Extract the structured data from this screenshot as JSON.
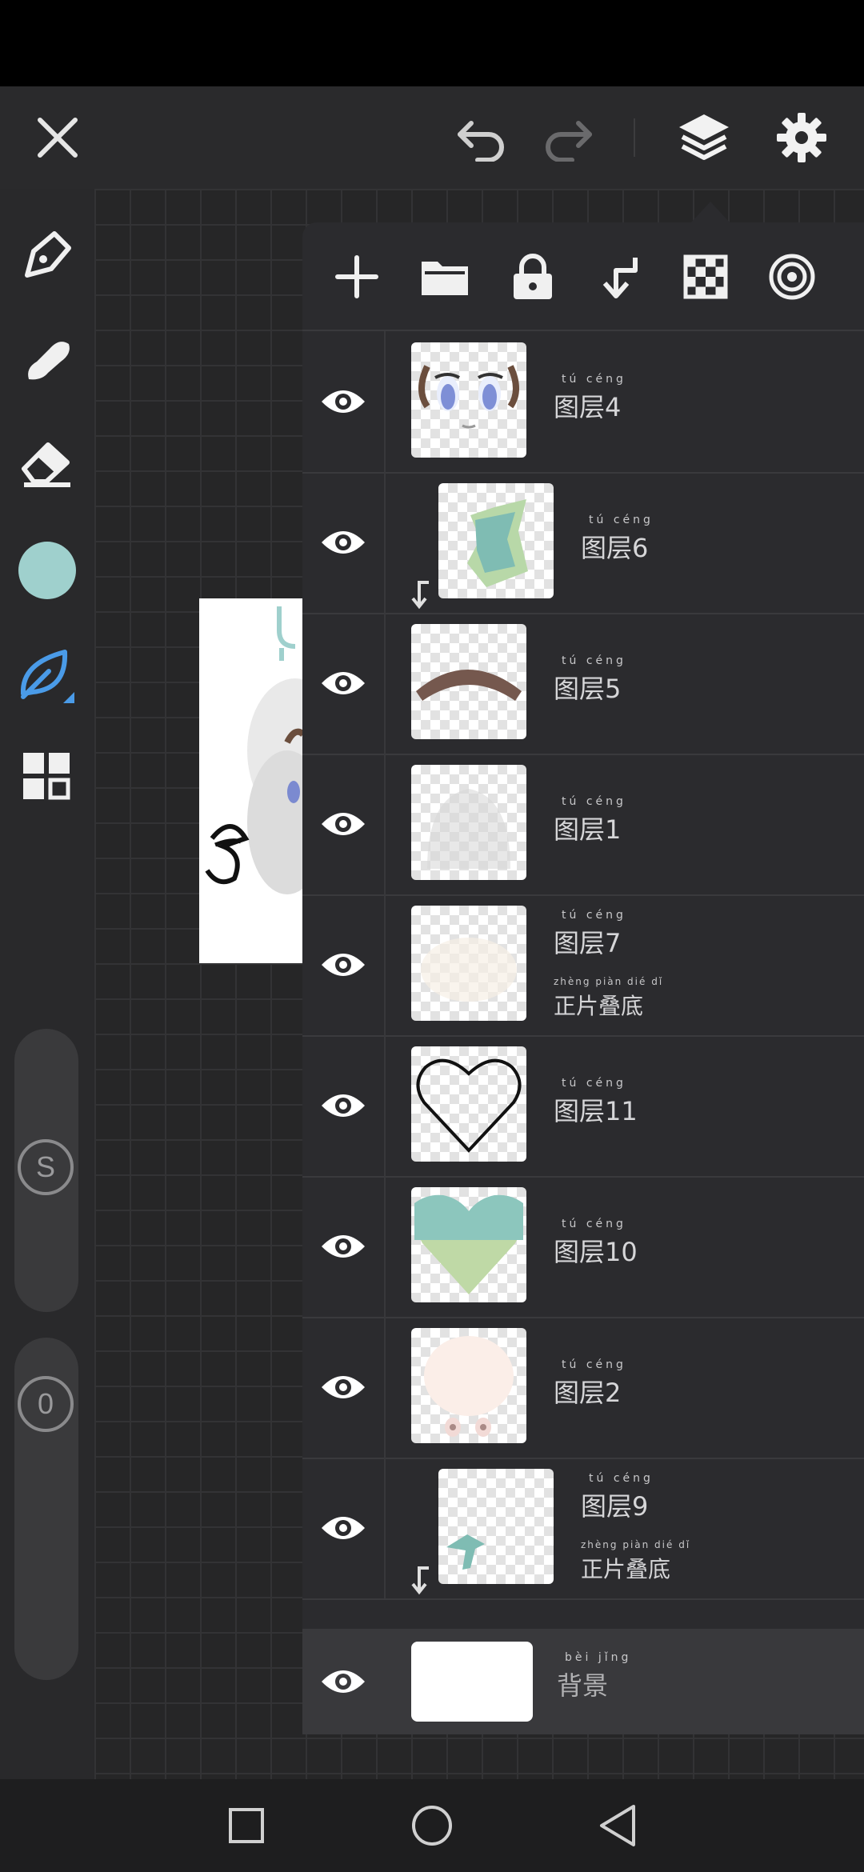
{
  "app": {
    "accent": "#4a9be8",
    "color_swatch": "#9fd0cd"
  },
  "topbar": {
    "close_icon": "close-icon",
    "undo_icon": "undo-icon",
    "redo_icon": "redo-icon",
    "layers_icon": "layers-icon",
    "settings_icon": "gear-icon"
  },
  "sidebar": {
    "tools": [
      "pen-icon",
      "smudge-icon",
      "eraser-icon",
      "color-swatch",
      "leaf-brush-icon",
      "grid-menu-icon"
    ],
    "size_label": "S",
    "opacity_label": "0"
  },
  "layer_panel": {
    "tools": [
      "add-layer-icon",
      "folder-icon",
      "lock-icon",
      "clip-mask-icon",
      "transparency-lock-icon",
      "target-icon"
    ],
    "layers": [
      {
        "pinyin": "tú céng",
        "name": "图层4",
        "blend_pinyin": "",
        "blend": "",
        "clipped": false
      },
      {
        "pinyin": "tú céng",
        "name": "图层6",
        "blend_pinyin": "",
        "blend": "",
        "clipped": true
      },
      {
        "pinyin": "tú céng",
        "name": "图层5",
        "blend_pinyin": "",
        "blend": "",
        "clipped": false
      },
      {
        "pinyin": "tú céng",
        "name": "图层1",
        "blend_pinyin": "",
        "blend": "",
        "clipped": false
      },
      {
        "pinyin": "tú céng",
        "name": "图层7",
        "blend_pinyin": "zhèng piàn dié dǐ",
        "blend": "正片叠底",
        "clipped": false
      },
      {
        "pinyin": "tú céng",
        "name": "图层11",
        "blend_pinyin": "",
        "blend": "",
        "clipped": false
      },
      {
        "pinyin": "tú céng",
        "name": "图层10",
        "blend_pinyin": "",
        "blend": "",
        "clipped": false
      },
      {
        "pinyin": "tú céng",
        "name": "图层2",
        "blend_pinyin": "",
        "blend": "",
        "clipped": false
      },
      {
        "pinyin": "tú céng",
        "name": "图层9",
        "blend_pinyin": "zhèng piàn dié dǐ",
        "blend": "正片叠底",
        "clipped": true
      }
    ],
    "background": {
      "pinyin": "bèi jǐng",
      "name": "背景"
    }
  },
  "navbar": {
    "recent": "square-icon",
    "home": "circle-icon",
    "back": "triangle-back-icon"
  }
}
